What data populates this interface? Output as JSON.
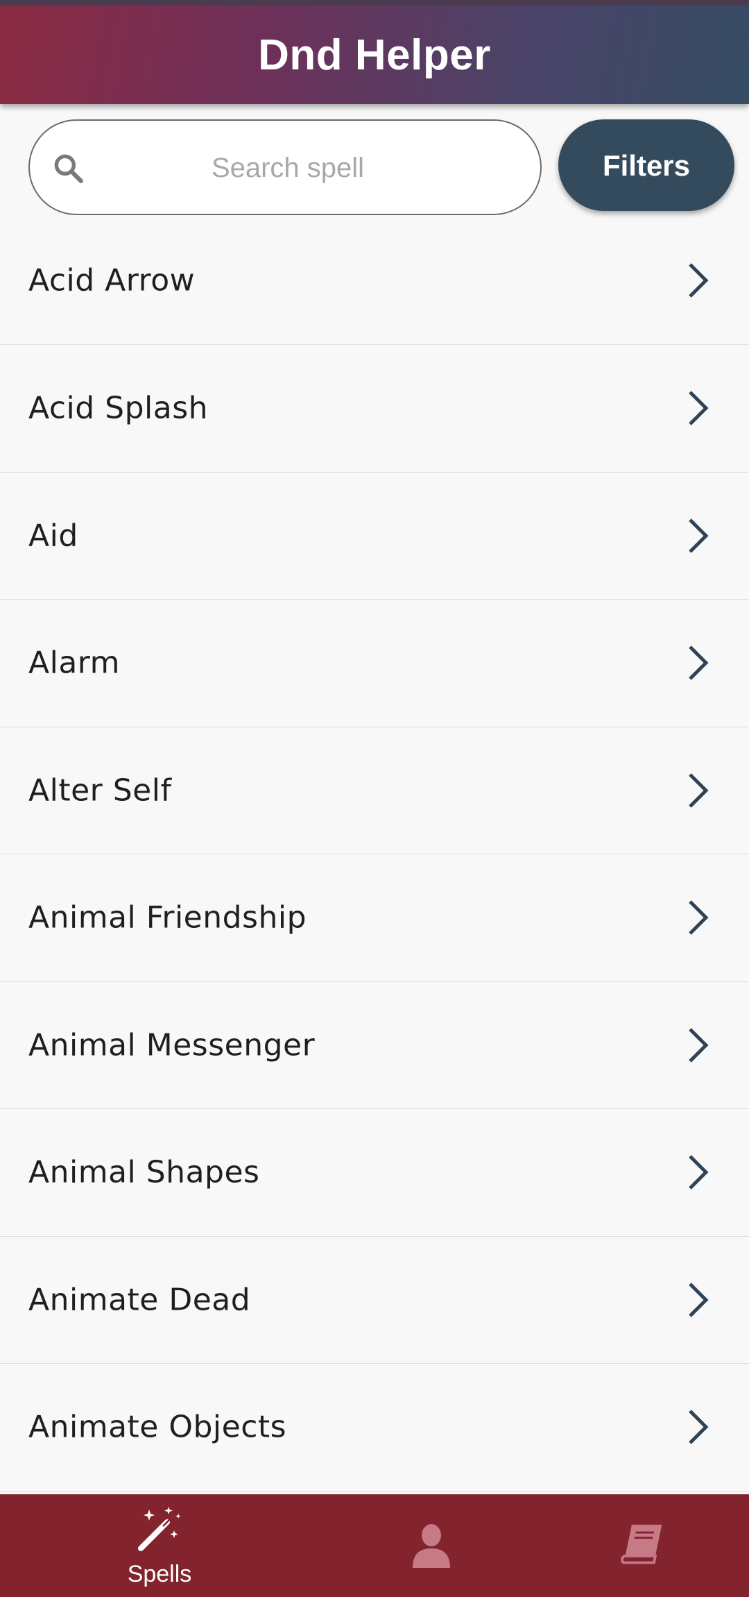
{
  "header": {
    "title": "Dnd Helper"
  },
  "search": {
    "placeholder": "Search spell",
    "value": ""
  },
  "filters": {
    "label": "Filters"
  },
  "spells": [
    "Acid Arrow",
    "Acid Splash",
    "Aid",
    "Alarm",
    "Alter Self",
    "Animal Friendship",
    "Animal Messenger",
    "Animal Shapes",
    "Animate Dead",
    "Animate Objects"
  ],
  "bottom_nav": {
    "spells_label": "Spells",
    "active": "spells",
    "icons": [
      "magic-wand-icon",
      "person-icon",
      "book-icon"
    ]
  },
  "colors": {
    "header_gradient_start": "#8b2a42",
    "header_gradient_end": "#354c63",
    "filters_button": "#344b5e",
    "bottom_nav": "#82232d",
    "chevron": "#2f4356",
    "inactive_nav_icon": "#c67a86"
  }
}
